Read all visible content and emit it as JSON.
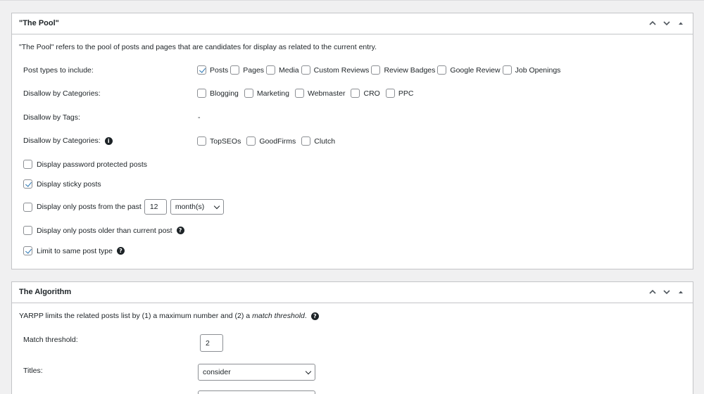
{
  "pool": {
    "title": "\"The Pool\"",
    "intro": "\"The Pool\" refers to the pool of posts and pages that are candidates for display as related to the current entry.",
    "post_types": {
      "label": "Post types to include:",
      "options": [
        {
          "label": "Posts",
          "checked": true
        },
        {
          "label": "Pages",
          "checked": false
        },
        {
          "label": "Media",
          "checked": false
        },
        {
          "label": "Custom Reviews",
          "checked": false
        },
        {
          "label": "Review Badges",
          "checked": false
        },
        {
          "label": "Google Review",
          "checked": false
        },
        {
          "label": "Job Openings",
          "checked": false
        }
      ]
    },
    "disallow_categories": {
      "label": "Disallow by Categories:",
      "options": [
        {
          "label": "Blogging",
          "checked": false
        },
        {
          "label": "Marketing",
          "checked": false
        },
        {
          "label": "Webmaster",
          "checked": false
        },
        {
          "label": "CRO",
          "checked": false
        },
        {
          "label": "PPC",
          "checked": false
        }
      ]
    },
    "disallow_tags": {
      "label": "Disallow by Tags:",
      "value": "-"
    },
    "disallow_categories2": {
      "label": "Disallow by Categories:",
      "options": [
        {
          "label": "TopSEOs",
          "checked": false
        },
        {
          "label": "GoodFirms",
          "checked": false
        },
        {
          "label": "Clutch",
          "checked": false
        }
      ]
    },
    "display_password": {
      "label": "Display password protected posts",
      "checked": false
    },
    "display_sticky": {
      "label": "Display sticky posts",
      "checked": true
    },
    "display_past": {
      "label": "Display only posts from the past",
      "checked": false,
      "value": "12",
      "unit": "month(s)"
    },
    "display_older": {
      "label": "Display only posts older than current post",
      "checked": false
    },
    "limit_same_type": {
      "label": "Limit to same post type",
      "checked": true
    }
  },
  "algorithm": {
    "title": "The Algorithm",
    "intro_prefix": "YARPP limits the related posts list by (1) a maximum number and (2) a ",
    "intro_em": "match threshold",
    "intro_suffix": ".",
    "match_threshold": {
      "label": "Match threshold:",
      "value": "2"
    },
    "titles": {
      "label": "Titles:",
      "value": "consider"
    }
  },
  "icons": {
    "move_up": "chevron-up-icon",
    "move_down": "chevron-down-icon",
    "toggle": "triangle-up-icon",
    "help": "question-circle-icon",
    "info": "info-circle-icon"
  }
}
